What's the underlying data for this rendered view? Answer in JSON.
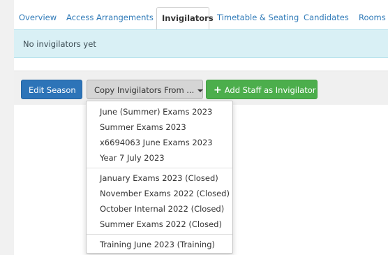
{
  "tabs": [
    {
      "label": "Overview"
    },
    {
      "label": "Access Arrangements"
    },
    {
      "label": "Invigilators"
    },
    {
      "label": "Timetable & Seating"
    },
    {
      "label": "Candidates"
    },
    {
      "label": "Rooms"
    }
  ],
  "active_tab": "Invigilators",
  "alert": {
    "text": "No invigilators yet"
  },
  "toolbar": {
    "edit_label": "Edit Season",
    "copy_label": "Copy Invigilators From ...",
    "add_label": "Add Staff as Invigilator"
  },
  "dropdown": {
    "groups": [
      [
        "June (Summer) Exams 2023",
        "Summer Exams 2023",
        "x6694063 June Exams 2023",
        "Year 7 July 2023"
      ],
      [
        "January Exams 2023 (Closed)",
        "November Exams 2022 (Closed)",
        "October Internal 2022 (Closed)",
        "Summer Exams 2022 (Closed)"
      ],
      [
        "Training June 2023 (Training)"
      ]
    ]
  },
  "colors": {
    "primary": "#2d74b8",
    "success": "#4cae4c",
    "info_bg": "#d9f0f5",
    "link": "#2f7ab8"
  },
  "icons": {
    "add": "plus-icon",
    "dropdown": "caret-down-icon"
  }
}
